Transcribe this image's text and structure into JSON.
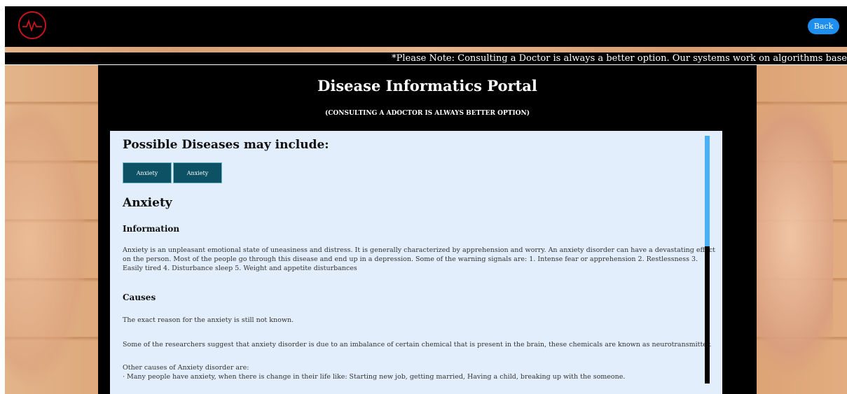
{
  "header": {
    "logo_icon": "heartbeat-icon",
    "back_label": "Back",
    "brand_color": "#c8141b",
    "accent_color": "#1f8ef1"
  },
  "notice": {
    "text": "*Please Note: Consulting a Doctor is always a better option. Our systems work on algorithms base"
  },
  "portal": {
    "title": "Disease Informatics Portal",
    "subtitle": "(CONSULTING A ADOCTOR IS ALWAYS BETTER OPTION)"
  },
  "results": {
    "heading": "Possible Diseases may include:",
    "chips": [
      "Anxiety",
      "Anxiety"
    ],
    "chip_color": "#0d5164",
    "disease_name": "Anxiety",
    "information_heading": "Information",
    "information_text": "Anxiety is an unpleasant emotional state of uneasiness and distress. It is generally characterized by apprehension and worry. An anxiety disorder can have a devastating effect on the person. Most of the people go through this disease and end up in a depression. Some of the warning signals are: 1. Intense fear or apprehension 2. Restlessness 3. Easily tired 4. Disturbance sleep 5. Weight and appetite disturbances",
    "causes_heading": "Causes",
    "causes_line1": "The exact reason for the anxiety is still not known.",
    "causes_line2": "Some of the researchers suggest that anxiety disorder is due to an imbalance of certain chemical that is present in the brain, these chemicals are known as neurotransmitter.",
    "causes_line3": "Other causes of Anxiety disorder are:",
    "causes_bullet1": "·  Many people have anxiety, when there is change in their life like: Starting new job,  getting married, Having a child, breaking up with the someone."
  }
}
